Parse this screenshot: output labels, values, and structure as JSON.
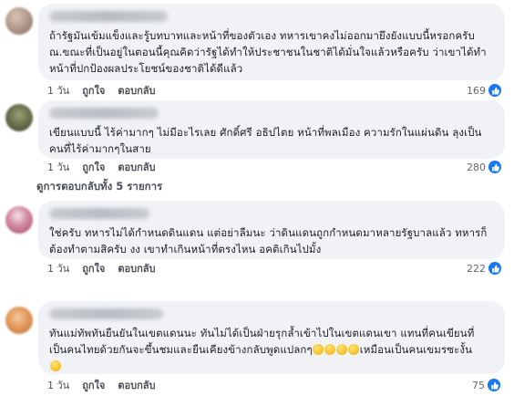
{
  "action_labels": {
    "like": "ถูกใจ",
    "reply": "ตอบกลับ"
  },
  "comments": [
    {
      "lines": [
        "ถ้ารัฐมันเข้มแข็งและรู้บทบาทและหน้าที่ของตัวเอง ทหารเขาคงไม่ออกมายึงยังแบบนี้หรอกครับ",
        "ณ.ขณะที่เป็นอยู่ในตอนนี้คุณคิดว่ารัฐได้ทำให้ประชาชนในชาติได้มั่นใจแล้วหรือครับ ว่าเขาได้ทำ",
        "หน้าที่ปกป้องผลประโยชน์ของชาติได้ดีแล้ว"
      ],
      "time": "1 วัน",
      "reactions": "169"
    },
    {
      "lines": [
        "เขียนแบบนี้ ไร้ค่ามากๆ ไม่มีอะไรเลย ศักดิ์ศรี อธิปไตย หน้าที่พลเมือง ความรักในแผ่นดิน ลุงเป็น",
        "คนที่ไร้ค่ามากๆในสาย"
      ],
      "time": "1 วัน",
      "reactions": "280"
    },
    {
      "lines": [
        "ใช่ครับ ทหารไม่ได้กำหนดดินแดน แต่อย่าลืมนะ ว่าดินแดนถูกกำหนดมาหลายรัฐบาลแล้ว ทหารก็",
        "ต้องทำตามสิครับ งง เขาทำเกินหน้าที่ตรงไหน อคติเกินไปมั้ง"
      ],
      "time": "1 วัน",
      "reactions": "222"
    },
    {
      "lines": [
        "ทันแม่ทัพทันยืนยันในเขตแดนนะ ทันไม่ได้เป็นฝ่ายรุกล้ำเข้าไปในเขตแดนเขา แทนที่คนเขียนที่",
        "เป็นคนไทยด้วยกันจะขึ้นชมและยืนเคียงข้างกลับพูดแปลกๆ",
        "เหมือนเป็นคนเขมรซะงั้น"
      ],
      "time": "1 วัน",
      "reactions": "75"
    }
  ],
  "view_replies": "ดูการตอบกลับทั้ง 5 รายการ",
  "colors": {
    "bubble": "#f0f2f5",
    "like_blue": "#1877f2",
    "text": "#1c1e21",
    "meta": "#65676b"
  }
}
